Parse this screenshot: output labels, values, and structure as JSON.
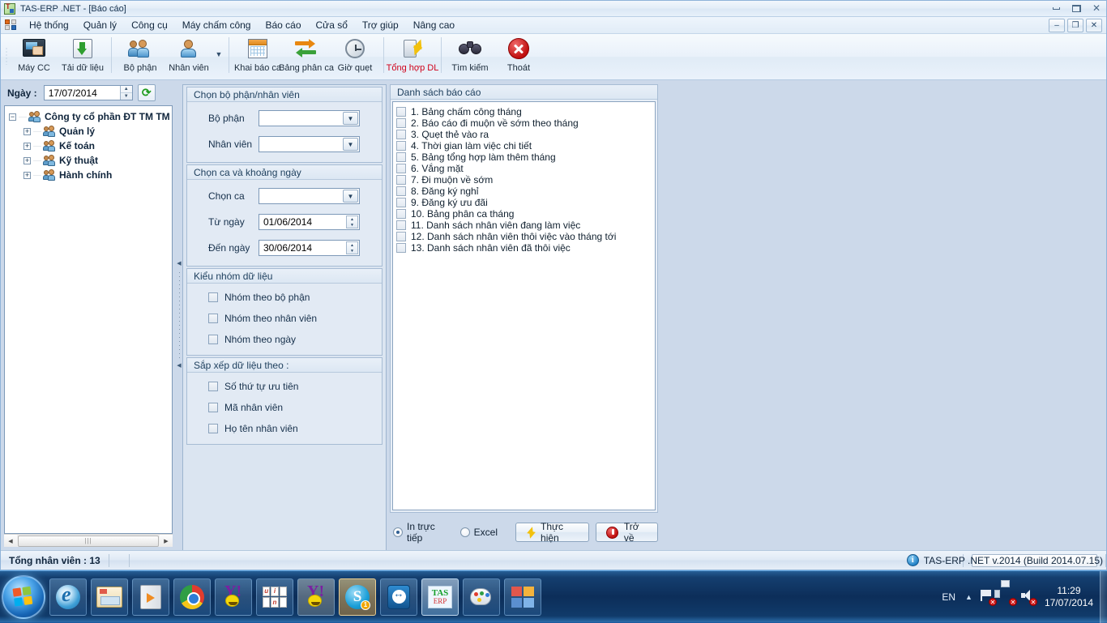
{
  "window": {
    "title": "TAS-ERP .NET - [Báo cáo]",
    "logo_icon": "tas-erp-logo-icon",
    "controls": {
      "minimize": "minimize-icon",
      "maximize": "maximize-icon",
      "close": "close-icon"
    },
    "mdi_controls": {
      "minimize": "–",
      "restore": "❐",
      "close": "✕"
    }
  },
  "menubar": {
    "app_icon": "windows-blocks-icon",
    "items": [
      {
        "label": "Hệ thống",
        "name": "menu-he-thong"
      },
      {
        "label": "Quản lý",
        "name": "menu-quan-ly"
      },
      {
        "label": "Công cụ",
        "name": "menu-cong-cu"
      },
      {
        "label": "Máy chấm công",
        "name": "menu-may-cham-cong"
      },
      {
        "label": "Báo cáo",
        "name": "menu-bao-cao"
      },
      {
        "label": "Cửa sổ",
        "name": "menu-cua-so"
      },
      {
        "label": "Trợ giúp",
        "name": "menu-tro-giup"
      },
      {
        "label": "Nâng cao",
        "name": "menu-nang-cao"
      }
    ]
  },
  "toolbar": {
    "items": [
      {
        "label": "Máy CC",
        "name": "toolbar-may-cc",
        "icon": "time-clock-machine-icon",
        "accent": false
      },
      {
        "label": "Tải dữ liệu",
        "name": "toolbar-tai-du-lieu",
        "icon": "download-data-icon",
        "accent": false
      },
      {
        "label": "Bộ phận",
        "name": "toolbar-bo-phan",
        "icon": "department-people-icon",
        "accent": false
      },
      {
        "label": "Nhân viên",
        "name": "toolbar-nhan-vien",
        "icon": "employee-person-icon",
        "accent": false
      },
      {
        "label": "Khai báo ca",
        "name": "toolbar-khai-bao-ca",
        "icon": "calendar-icon",
        "accent": false
      },
      {
        "label": "Bảng phân ca",
        "name": "toolbar-bang-phan-ca",
        "icon": "swap-arrows-icon",
        "accent": false
      },
      {
        "label": "Giờ quẹt",
        "name": "toolbar-gio-quet",
        "icon": "clock-icon",
        "accent": false
      },
      {
        "label": "Tổng hợp DL",
        "name": "toolbar-tong-hop-dl",
        "icon": "data-sync-bolt-icon",
        "accent": true
      },
      {
        "label": "Tìm kiếm",
        "name": "toolbar-tim-kiem",
        "icon": "binoculars-icon",
        "accent": false
      },
      {
        "label": "Thoát",
        "name": "toolbar-thoat",
        "icon": "exit-red-x-icon",
        "accent": false
      }
    ],
    "dropdown_icon": "chevron-down-icon",
    "accent_color": "#d0021b"
  },
  "left_panel": {
    "date_label": "Ngày :",
    "date_value": "17/07/2014",
    "refresh_icon": "refresh-icon",
    "tree": [
      {
        "label": "Công ty cổ phần ĐT TM TM Hà Thà",
        "level": 0,
        "expander": "−"
      },
      {
        "label": "Quản lý",
        "level": 1,
        "expander": "+"
      },
      {
        "label": "Kế toán",
        "level": 1,
        "expander": "+"
      },
      {
        "label": "Kỹ thuật",
        "level": 1,
        "expander": "+"
      },
      {
        "label": "Hành chính",
        "level": 1,
        "expander": "+"
      }
    ],
    "scroll_left_icon": "◀",
    "scroll_right_icon": "▶",
    "scroll_grip": "|||"
  },
  "splitter": {
    "up_icon": "◀",
    "down_icon": "◀"
  },
  "form": {
    "group_employee": {
      "title": "Chọn bộ phận/nhân viên",
      "fields": [
        {
          "label": "Bộ phận",
          "value": "",
          "name": "bo-phan-combo"
        },
        {
          "label": "Nhân viên",
          "value": "",
          "name": "nhan-vien-combo"
        }
      ]
    },
    "group_shift": {
      "title": "Chọn ca  và khoảng ngày",
      "shift": {
        "label": "Chọn ca",
        "value": "",
        "name": "chon-ca-combo"
      },
      "from": {
        "label": "Từ ngày",
        "value": "01/06/2014",
        "name": "tu-ngay-date"
      },
      "to": {
        "label": "Đến ngày",
        "value": "30/06/2014",
        "name": "den-ngay-date"
      }
    },
    "group_group_by": {
      "title": "Kiểu nhóm dữ liệu",
      "items": [
        {
          "label": "Nhóm theo bộ phận",
          "checked": false
        },
        {
          "label": "Nhóm theo nhân viên",
          "checked": false
        },
        {
          "label": "Nhóm theo ngày",
          "checked": false
        }
      ]
    },
    "group_sort": {
      "title": "Sắp xếp dữ liệu theo :",
      "items": [
        {
          "label": "Số thứ tự ưu tiên",
          "checked": false
        },
        {
          "label": "Mã nhân viên",
          "checked": false
        },
        {
          "label": "Họ tên nhân viên",
          "checked": false
        }
      ]
    }
  },
  "report": {
    "title": "Danh sách báo cáo",
    "items": [
      {
        "label": "1. Bảng chấm công tháng",
        "checked": false
      },
      {
        "label": "2. Báo cáo đi muộn về sớm theo tháng",
        "checked": false
      },
      {
        "label": "3. Quẹt thẻ vào ra",
        "checked": false
      },
      {
        "label": "4. Thời gian làm việc chi tiết",
        "checked": false
      },
      {
        "label": "5. Bảng tổng hợp làm thêm tháng",
        "checked": false
      },
      {
        "label": "6. Vắng mặt",
        "checked": false
      },
      {
        "label": "7. Đi muộn về sớm",
        "checked": false
      },
      {
        "label": "8. Đăng ký nghỉ",
        "checked": false
      },
      {
        "label": "9. Đăng ký ưu đãi",
        "checked": false
      },
      {
        "label": "10. Bảng phân ca tháng",
        "checked": false
      },
      {
        "label": "11. Danh sách nhân viên đang làm việc",
        "checked": false
      },
      {
        "label": "12. Danh sách nhân viên thôi việc vào tháng tới",
        "checked": false
      },
      {
        "label": "13. Danh sách nhân viên đã thôi việc",
        "checked": false
      }
    ],
    "output": [
      {
        "label": "In trực tiếp",
        "selected": true,
        "name": "radio-in-truc-tiep"
      },
      {
        "label": "Excel",
        "selected": false,
        "name": "radio-excel"
      }
    ],
    "execute_button": {
      "label": "Thực hiện",
      "icon": "lightning-bolt-icon"
    },
    "back_button": {
      "label": "Trở về",
      "icon": "back-red-circle-icon"
    }
  },
  "statusbar": {
    "total_employees": "Tổng nhân viên : 13",
    "info_icon": "info-icon",
    "version": "TAS-ERP .NET v.2014 (Build 2014.07.15)"
  },
  "taskbar": {
    "start_icon": "windows-start-orb-icon",
    "buttons": [
      {
        "name": "taskbar-internet-explorer",
        "icon": "internet-explorer-icon",
        "style": ""
      },
      {
        "name": "taskbar-windows-explorer",
        "icon": "windows-explorer-icon",
        "style": ""
      },
      {
        "name": "taskbar-media-player",
        "icon": "media-player-icon",
        "style": ""
      },
      {
        "name": "taskbar-google-chrome",
        "icon": "chrome-icon",
        "style": ""
      },
      {
        "name": "taskbar-yahoo-messenger",
        "icon": "yahoo-messenger-icon",
        "style": ""
      },
      {
        "name": "taskbar-unikey",
        "icon": "unikey-icon",
        "style": ""
      },
      {
        "name": "taskbar-yahoo-messenger-2",
        "icon": "yahoo-messenger-icon",
        "style": "gray"
      },
      {
        "name": "taskbar-skype",
        "icon": "skype-icon",
        "style": "amber",
        "badge": "1"
      },
      {
        "name": "taskbar-teamviewer",
        "icon": "teamviewer-icon",
        "style": ""
      },
      {
        "name": "taskbar-tas-erp",
        "icon": "tas-erp-icon",
        "style": "active"
      },
      {
        "name": "taskbar-paint",
        "icon": "paint-icon",
        "style": ""
      },
      {
        "name": "taskbar-office",
        "icon": "office-icon",
        "style": ""
      }
    ],
    "unikey_keys": [
      "u",
      "i",
      "n"
    ],
    "tas_top": "TAS",
    "tas_bottom": "ERP",
    "tray": {
      "language": "EN",
      "show_hidden_icon": "▲",
      "flag_icon": "action-center-flag-icon",
      "network_icon": "network-icon",
      "volume_icon": "volume-muted-icon",
      "time": "11:29",
      "date": "17/07/2014"
    }
  }
}
